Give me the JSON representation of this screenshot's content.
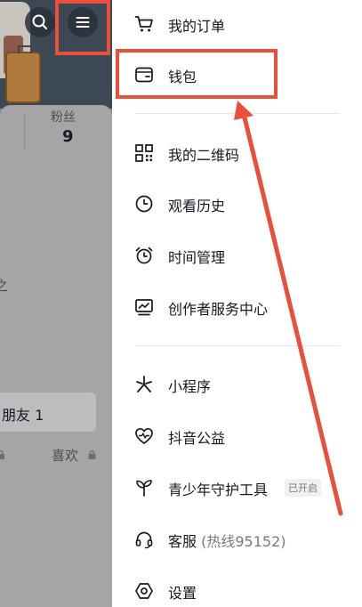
{
  "profile": {
    "fans_label": "粉丝",
    "fans_count": "9",
    "partial_text_1": "之",
    "partial_text_2": "",
    "friends_label": "朋友 1",
    "likes_tab": "喜欢"
  },
  "menu": {
    "items": [
      {
        "label": "我的订单",
        "icon": "shopping-cart-icon"
      },
      {
        "label": "钱包",
        "icon": "wallet-icon"
      },
      {
        "label": "我的二维码",
        "icon": "qr-code-icon"
      },
      {
        "label": "观看历史",
        "icon": "clock-icon"
      },
      {
        "label": "时间管理",
        "icon": "alarm-clock-icon"
      },
      {
        "label": "创作者服务中心",
        "icon": "chart-monitor-icon"
      },
      {
        "label": "小程序",
        "icon": "asterisk-icon"
      },
      {
        "label": "抖音公益",
        "icon": "heart-icon"
      },
      {
        "label": "青少年守护工具",
        "icon": "sprout-icon",
        "badge": "已开启"
      },
      {
        "label": "客服",
        "sub": "(热线95152)",
        "icon": "headset-icon"
      },
      {
        "label": "设置",
        "icon": "hexagon-gear-icon"
      }
    ]
  },
  "colors": {
    "highlight": "#ea4f3c",
    "text_primary": "#161823",
    "text_secondary": "#777980"
  }
}
